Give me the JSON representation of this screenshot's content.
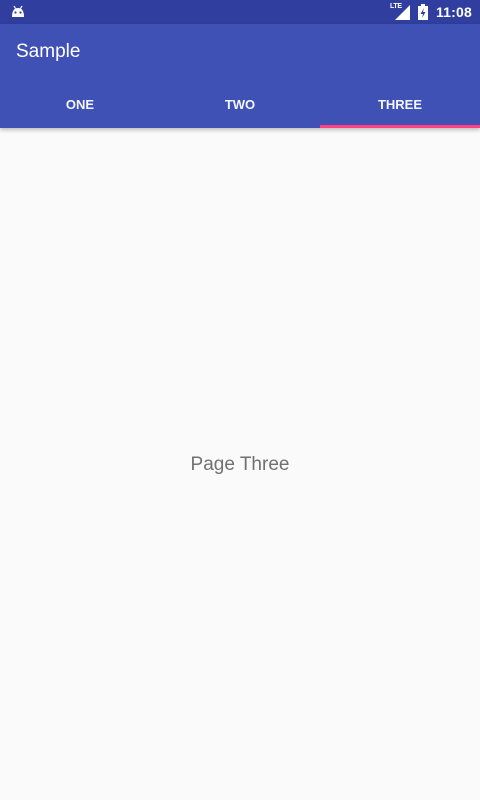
{
  "status_bar": {
    "notification_icon": "android-icon",
    "network_label": "LTE",
    "signal_icon": "signal-icon",
    "battery_icon": "battery-charging-icon",
    "time": "11:08"
  },
  "app_bar": {
    "title": "Sample"
  },
  "tabs": [
    {
      "label": "ONE",
      "selected": false
    },
    {
      "label": "TWO",
      "selected": false
    },
    {
      "label": "THREE",
      "selected": true
    }
  ],
  "content": {
    "page_label": "Page Three"
  },
  "colors": {
    "status_bar": "#303f9f",
    "primary": "#3f51b5",
    "accent": "#ff4081",
    "background": "#fafafa",
    "page_text": "#707070"
  }
}
